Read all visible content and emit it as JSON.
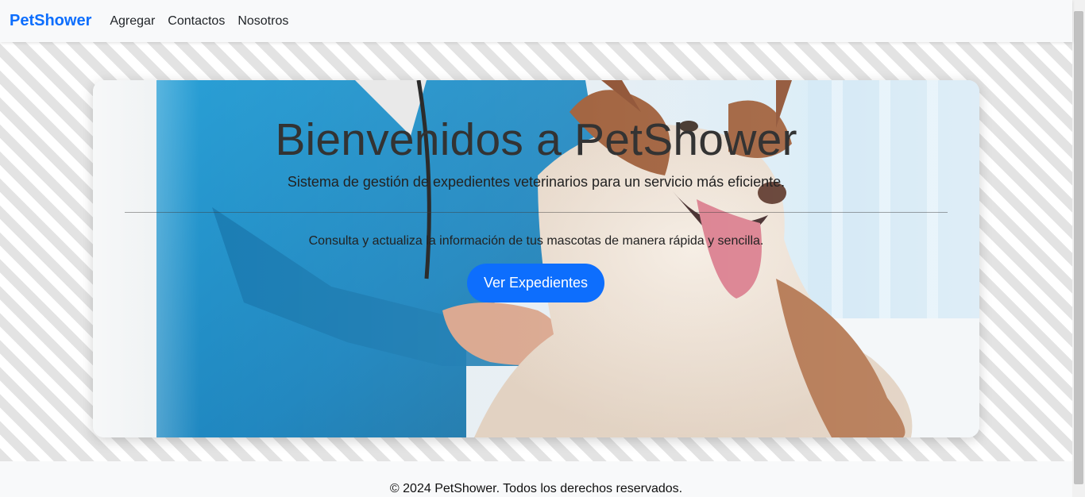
{
  "navbar": {
    "brand": "PetShower",
    "links": [
      "Agregar",
      "Contactos",
      "Nosotros"
    ]
  },
  "hero": {
    "image_description_icon": "veterinarian-with-husky-image",
    "title": "Bienvenidos a PetShower",
    "subtitle": "Sistema de gestión de expedientes veterinarios para un servicio más eficiente.",
    "text": "Consulta y actualiza la información de tus mascotas de manera rápida y sencilla.",
    "button_label": "Ver Expedientes"
  },
  "footer": {
    "text": "© 2024 PetShower. Todos los derechos reservados."
  },
  "colors": {
    "brand": "#0d6efd",
    "button": "#0d6efd",
    "navbar_bg": "#f8f9fa",
    "stripe": "#e3e3e3"
  }
}
